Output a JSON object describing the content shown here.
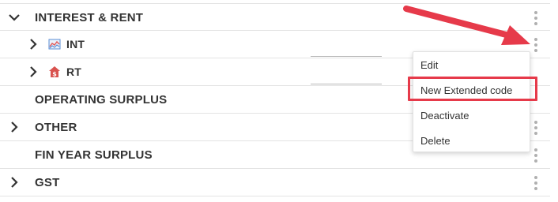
{
  "rows": [
    {
      "label": "INTEREST & RENT"
    },
    {
      "label": "INT"
    },
    {
      "label": "RT"
    },
    {
      "label": "OPERATING SURPLUS"
    },
    {
      "label": "OTHER"
    },
    {
      "label": "FIN YEAR SURPLUS"
    },
    {
      "label": "GST"
    }
  ],
  "context_menu": {
    "items": [
      {
        "label": "Edit"
      },
      {
        "label": "New Extended code"
      },
      {
        "label": "Deactivate"
      },
      {
        "label": "Delete"
      }
    ]
  },
  "colors": {
    "annotation_red": "#e63a4a",
    "chart_icon_blue": "#5b8ed6",
    "chart_icon_red": "#e05a5a",
    "home_icon_red": "#d9534f"
  },
  "icons": {
    "expanded": "chevron-down-icon",
    "collapsed": "chevron-right-icon",
    "int_icon": "line-chart-icon",
    "rt_icon": "home-dollar-icon",
    "row_menu": "kebab-menu-icon"
  }
}
